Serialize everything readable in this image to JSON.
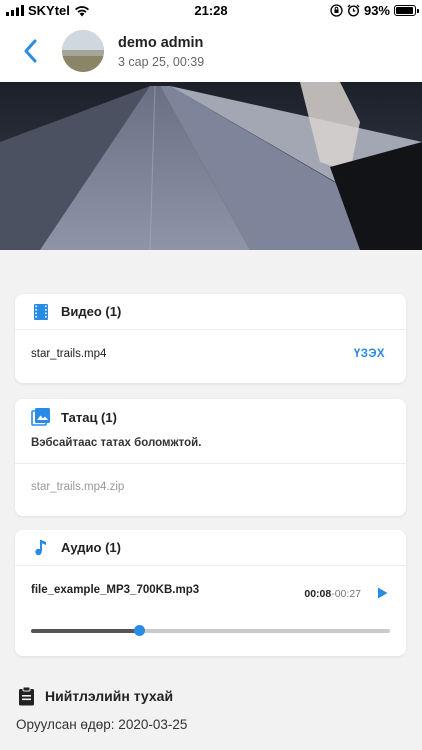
{
  "status_bar": {
    "carrier": "SKYtel",
    "time": "21:28",
    "battery": "93%",
    "battery_level": 0.93
  },
  "header": {
    "user_name": "demo admin",
    "timestamp": "3 сар 25, 00:39"
  },
  "video_section": {
    "title": "Видео (1)",
    "filename": "star_trails.mp4",
    "view_label": "ҮЗЭХ"
  },
  "download_section": {
    "title": "Татац (1)",
    "description": "Вэбсайтаас татах боломжтой.",
    "filename": "star_trails.mp4.zip"
  },
  "audio_section": {
    "title": "Аудио (1)",
    "filename": "file_example_MP3_700KB.mp3",
    "current_time": "00:08",
    "separator": "-",
    "total_time": "00:27",
    "progress": 0.3
  },
  "about": {
    "title": "Нийтлэлийн тухай",
    "date_label": "Оруулсан өдөр: 2020-03-25"
  },
  "colors": {
    "accent": "#2a8be4"
  }
}
